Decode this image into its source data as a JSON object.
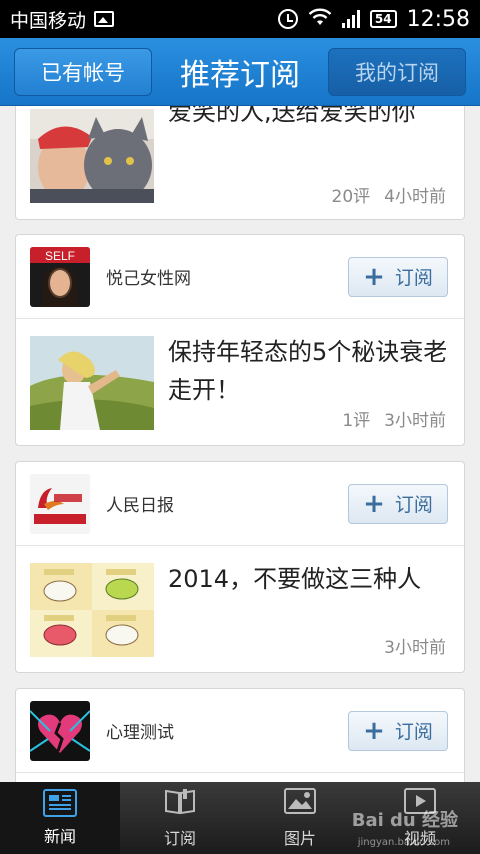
{
  "status_bar": {
    "carrier": "中国移动",
    "battery": "54",
    "time": "12:58"
  },
  "header": {
    "left_button": "已有帐号",
    "title": "推荐订阅",
    "right_button": "我的订阅"
  },
  "feed": {
    "partial_article": {
      "headline": "爱笑的人,送给爱笑的你",
      "comments": "20评",
      "time": "4小时前"
    },
    "cards": [
      {
        "source": "悦己女性网",
        "subscribe_label": "订阅",
        "headline": "保持年轻态的5个秘诀衰老走开！",
        "comments": "1评",
        "time": "3小时前"
      },
      {
        "source": "人民日报",
        "subscribe_label": "订阅",
        "headline": "2014，不要做这三种人",
        "comments": "",
        "time": "3小时前"
      },
      {
        "source": "心理测试",
        "subscribe_label": "订阅"
      }
    ]
  },
  "bottom_nav": {
    "items": [
      {
        "label": "新闻",
        "icon": "newspaper-icon",
        "active": true
      },
      {
        "label": "订阅",
        "icon": "book-icon",
        "active": false
      },
      {
        "label": "图片",
        "icon": "picture-icon",
        "active": false
      },
      {
        "label": "视频",
        "icon": "video-icon",
        "active": false
      }
    ]
  },
  "watermark": {
    "logo": "Bai du 经验",
    "url": "jingyan.baidu.com"
  },
  "colors": {
    "header_blue": "#1f85d6",
    "subscribe_text": "#3a6d9e",
    "active_tab_icon": "#3fa1e8"
  }
}
